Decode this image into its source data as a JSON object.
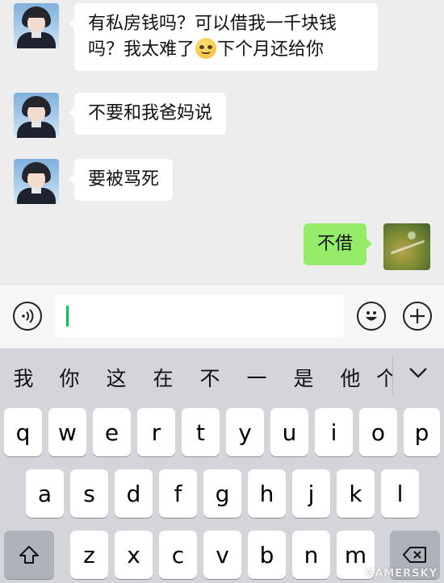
{
  "messages": [
    {
      "side": "left",
      "text_parts": [
        "有私房钱吗？可以借我一千块钱",
        "吗？我太难了",
        "下个月还给你"
      ],
      "emoji": "drooling-face"
    },
    {
      "side": "left",
      "text": "不要和我爸妈说"
    },
    {
      "side": "left",
      "text": "要被骂死"
    },
    {
      "side": "right",
      "text": "不借"
    }
  ],
  "input": {
    "value": "",
    "placeholder": ""
  },
  "icons": {
    "voice": "voice-icon",
    "emoji": "smiley-icon",
    "more": "plus-icon"
  },
  "candidates": [
    "我",
    "你",
    "这",
    "在",
    "不",
    "一",
    "是",
    "他",
    "个"
  ],
  "keyboard": {
    "row1": [
      "q",
      "w",
      "e",
      "r",
      "t",
      "y",
      "u",
      "i",
      "o",
      "p"
    ],
    "row2": [
      "a",
      "s",
      "d",
      "f",
      "g",
      "h",
      "j",
      "k",
      "l"
    ],
    "row3": [
      "z",
      "x",
      "c",
      "v",
      "b",
      "n",
      "m"
    ]
  },
  "watermark": "GAMERSKY",
  "colors": {
    "my_bubble": "#95ec69",
    "their_bubble": "#ffffff",
    "caret": "#07c160",
    "background": "#ededed"
  }
}
